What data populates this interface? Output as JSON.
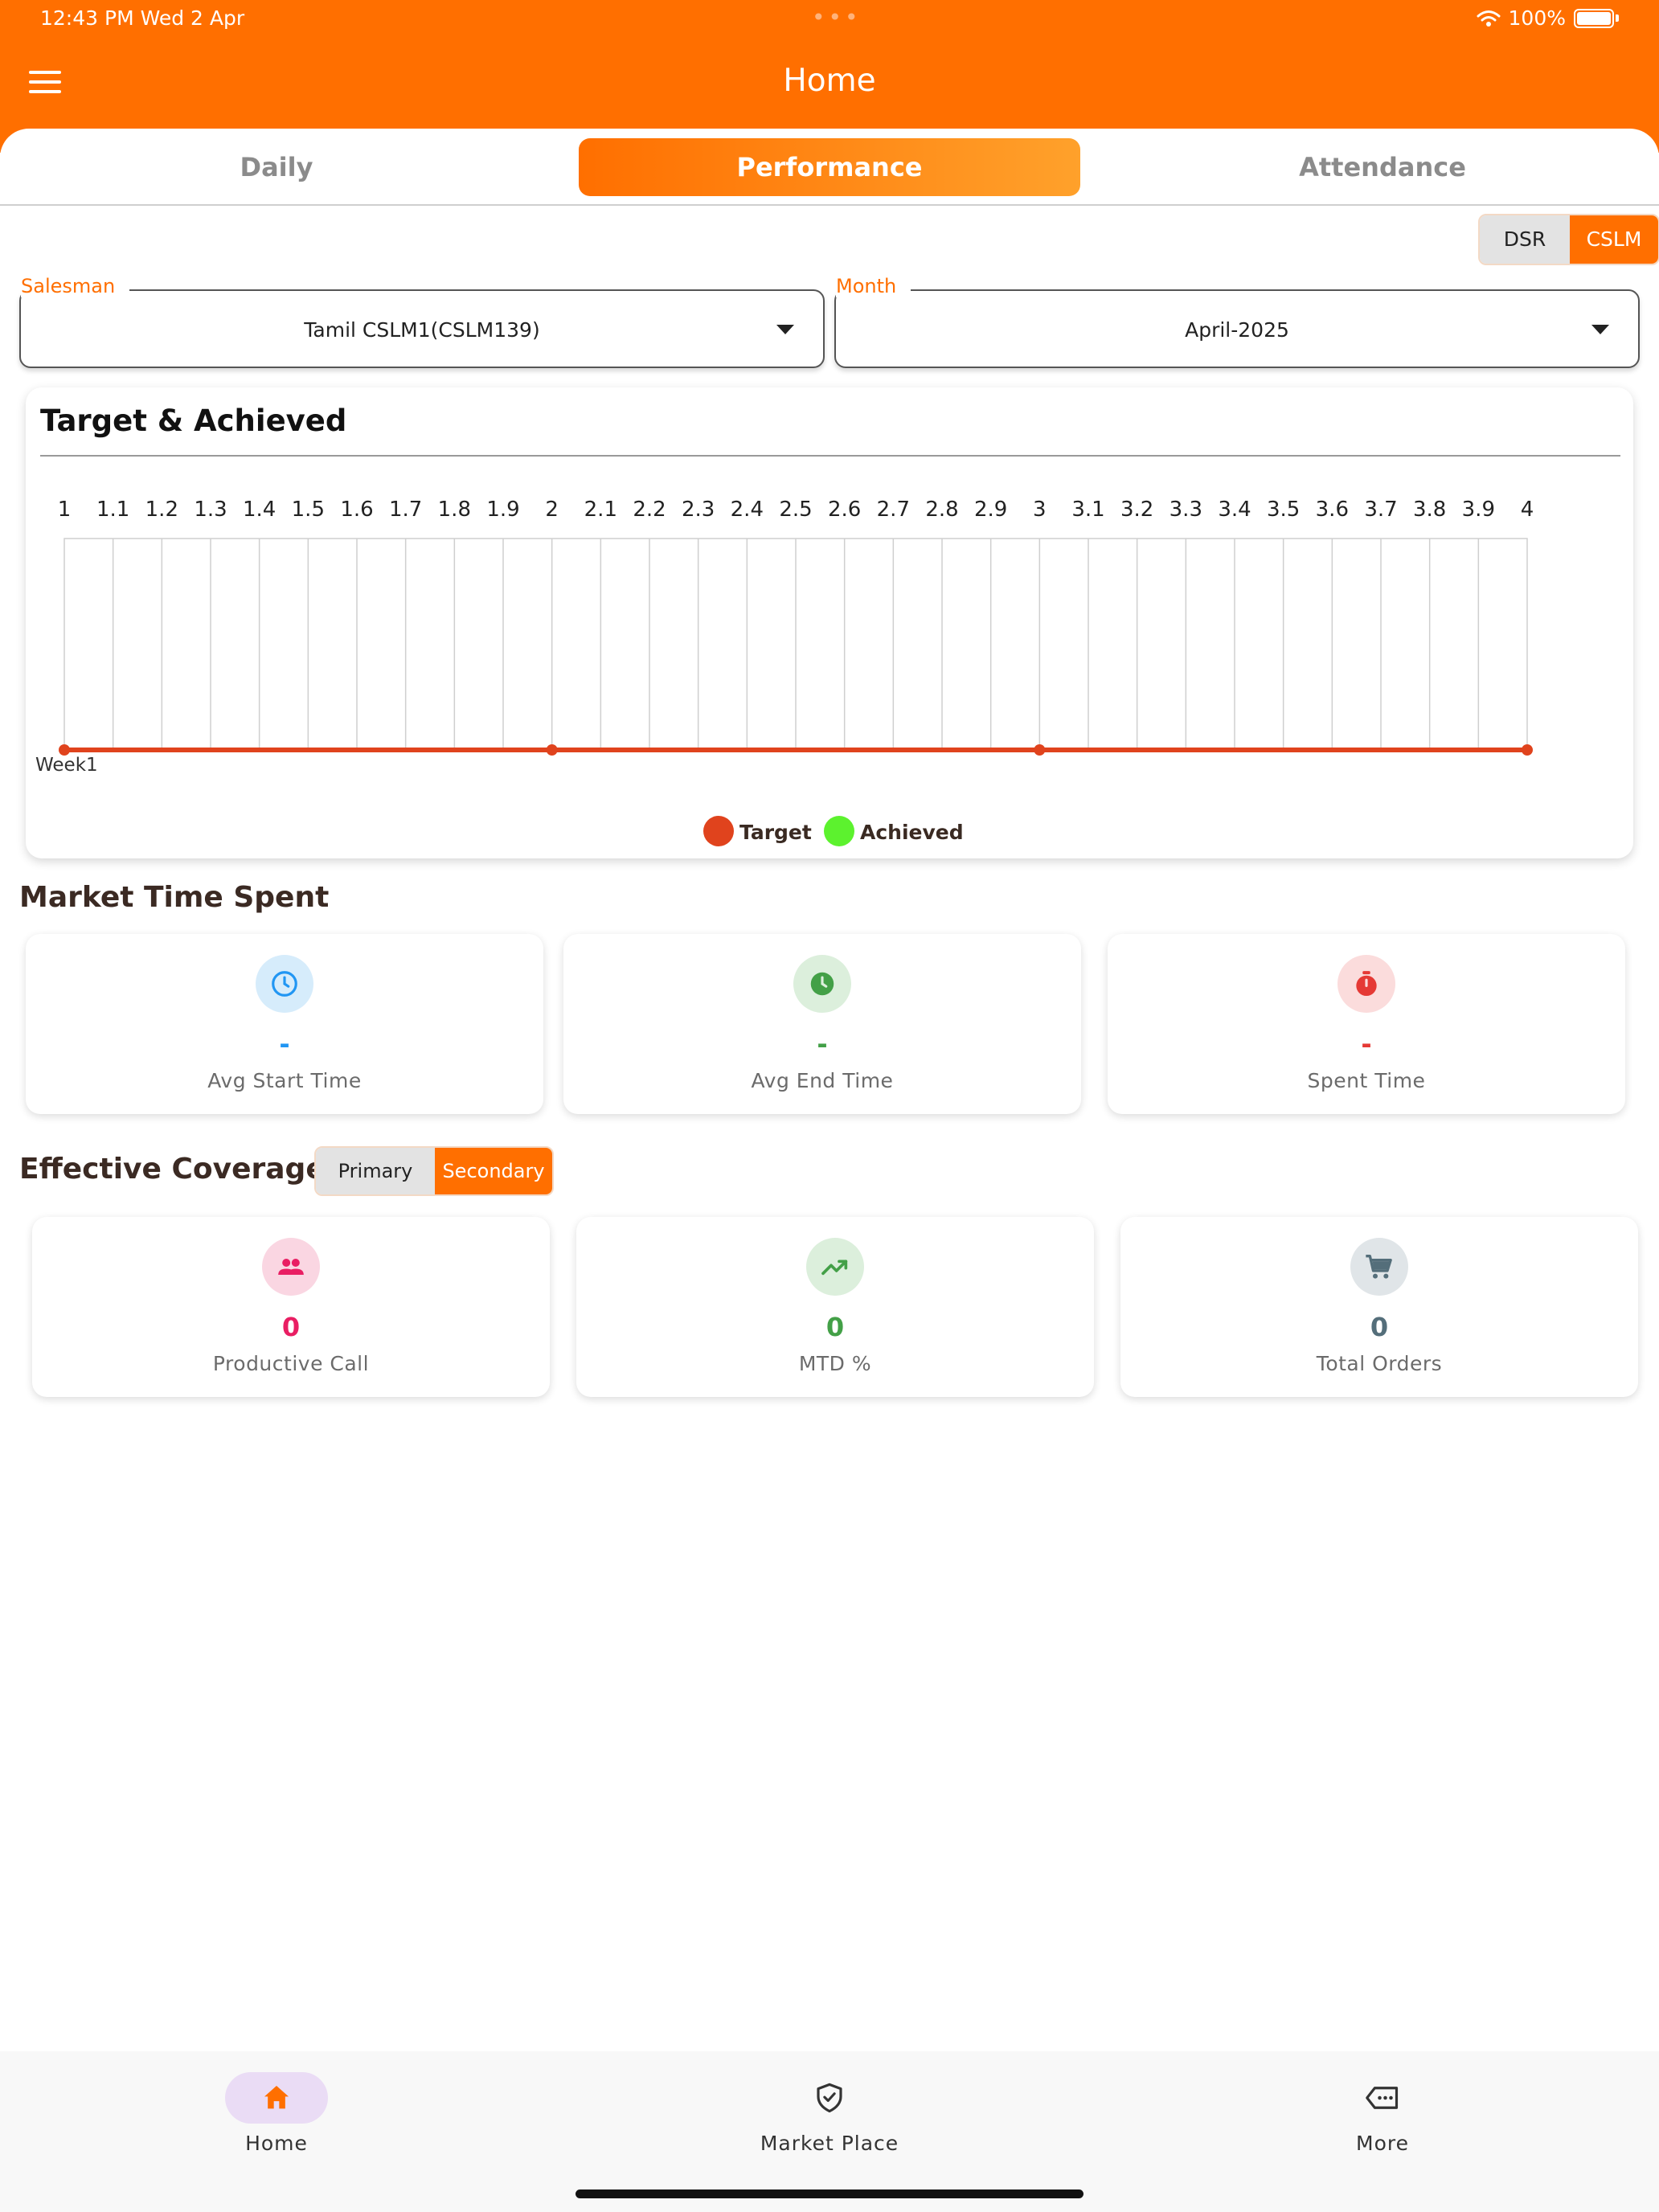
{
  "status_bar": {
    "time": "12:43 PM   Wed 2 Apr",
    "battery": "100%"
  },
  "header": {
    "title": "Home"
  },
  "tabs": [
    {
      "label": "Daily",
      "active": false
    },
    {
      "label": "Performance",
      "active": true
    },
    {
      "label": "Attendance",
      "active": false
    }
  ],
  "role_toggle": {
    "options": [
      "DSR",
      "CSLM"
    ],
    "selected": "CSLM"
  },
  "filters": {
    "salesman": {
      "label": "Salesman",
      "value": "Tamil CSLM1(CSLM139)"
    },
    "month": {
      "label": "Month",
      "value": "April-2025"
    }
  },
  "target_card": {
    "title": "Target & Achieved"
  },
  "chart_data": {
    "type": "line",
    "x": [
      "1",
      "1.1",
      "1.2",
      "1.3",
      "1.4",
      "1.5",
      "1.6",
      "1.7",
      "1.8",
      "1.9",
      "2",
      "2.1",
      "2.2",
      "2.3",
      "2.4",
      "2.5",
      "2.6",
      "2.7",
      "2.8",
      "2.9",
      "3",
      "3.1",
      "3.2",
      "3.3",
      "3.4",
      "3.5",
      "3.6",
      "3.7",
      "3.8",
      "3.9",
      "4"
    ],
    "category_label": "Week1",
    "series": [
      {
        "name": "Target",
        "color": "#e0431d",
        "points": [
          [
            1,
            0
          ],
          [
            2,
            0
          ],
          [
            3,
            0
          ],
          [
            4,
            0
          ]
        ]
      },
      {
        "name": "Achieved",
        "color": "#5cf22e",
        "points": []
      }
    ],
    "legend": "bottom-center",
    "grid": true
  },
  "market_time": {
    "title": "Market Time Spent",
    "cards": [
      {
        "value": "-",
        "label": "Avg Start Time",
        "icon": "clock-outline-icon",
        "color": "#2196f3",
        "bg": "#d6ecfb"
      },
      {
        "value": "-",
        "label": "Avg End Time",
        "icon": "clock-filled-icon",
        "color": "#43a047",
        "bg": "#dcefdc"
      },
      {
        "value": "-",
        "label": "Spent Time",
        "icon": "stopwatch-icon",
        "color": "#e53935",
        "bg": "#fbdcdc"
      }
    ]
  },
  "coverage": {
    "title": "Effective Coverage",
    "toggle": {
      "options": [
        "Primary",
        "Secondary"
      ],
      "selected": "Secondary"
    },
    "cards": [
      {
        "value": "0",
        "label": "Productive Call",
        "icon": "people-icon",
        "color": "#e91e63",
        "bg": "#fad6e2"
      },
      {
        "value": "0",
        "label": "MTD %",
        "icon": "trending-up-icon",
        "color": "#43a047",
        "bg": "#dcefdc"
      },
      {
        "value": "0",
        "label": "Total Orders",
        "icon": "cart-icon",
        "color": "#546e7a",
        "bg": "#e0e5e8"
      }
    ]
  },
  "bottom_nav": [
    {
      "label": "Home",
      "icon": "home-icon",
      "active": true
    },
    {
      "label": "Market Place",
      "icon": "shield-check-icon",
      "active": false
    },
    {
      "label": "More",
      "icon": "tag-more-icon",
      "active": false
    }
  ],
  "colors": {
    "accent": "#ff6f00",
    "target": "#e0431d",
    "achieved": "#5cf22e"
  }
}
